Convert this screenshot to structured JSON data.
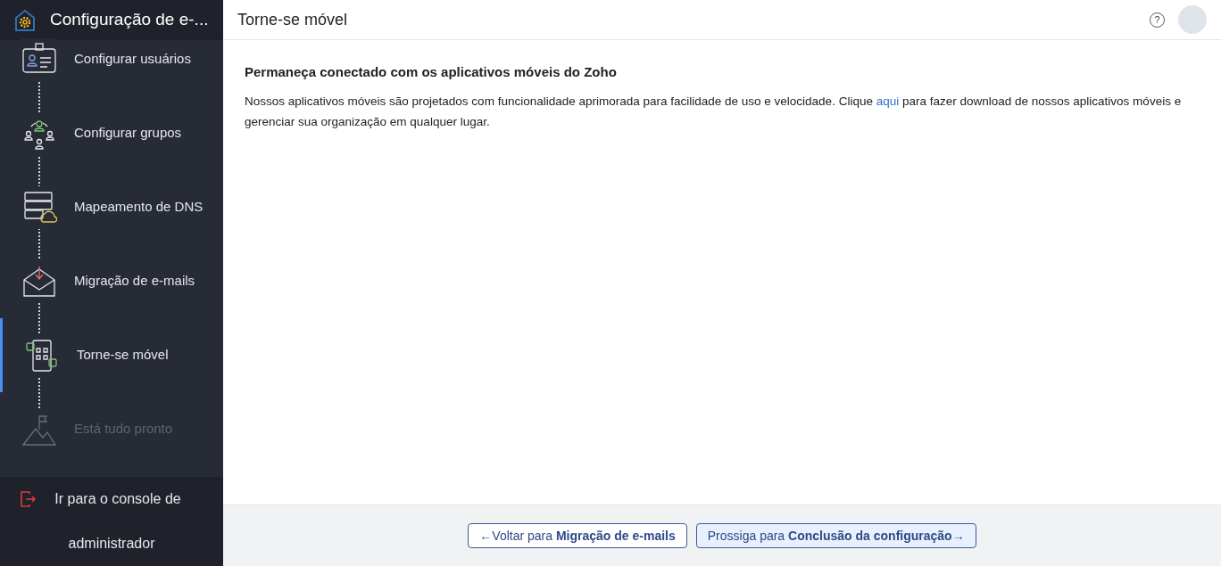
{
  "sidebar": {
    "title": "Configuração de e-...",
    "steps": [
      {
        "label": "Configurar usuários",
        "selected": false,
        "disabled": false
      },
      {
        "label": "Configurar grupos",
        "selected": false,
        "disabled": false
      },
      {
        "label": "Mapeamento de DNS",
        "selected": false,
        "disabled": false
      },
      {
        "label": "Migração de e-mails",
        "selected": false,
        "disabled": false
      },
      {
        "label": "Torne-se móvel",
        "selected": true,
        "disabled": false
      },
      {
        "label": "Está tudo pronto",
        "selected": false,
        "disabled": true
      }
    ],
    "footer_link": "Ir para o console de administrador"
  },
  "header": {
    "title": "Torne-se móvel",
    "help": "?"
  },
  "content": {
    "heading": "Permaneça conectado com os aplicativos móveis do Zoho",
    "text_before": "Nossos aplicativos móveis são projetados com funcionalidade aprimorada para facilidade de uso e velocidade. Clique",
    "link": "aqui",
    "text_after": "para fazer download de nossos aplicativos móveis e gerenciar sua organização em qualquer lugar."
  },
  "buttons": [
    {
      "label": "←Voltar para **Migração de e-mails**",
      "hover": false
    },
    {
      "label": "Prossiga para **Conclusão da configuração**→",
      "hover": true
    }
  ]
}
